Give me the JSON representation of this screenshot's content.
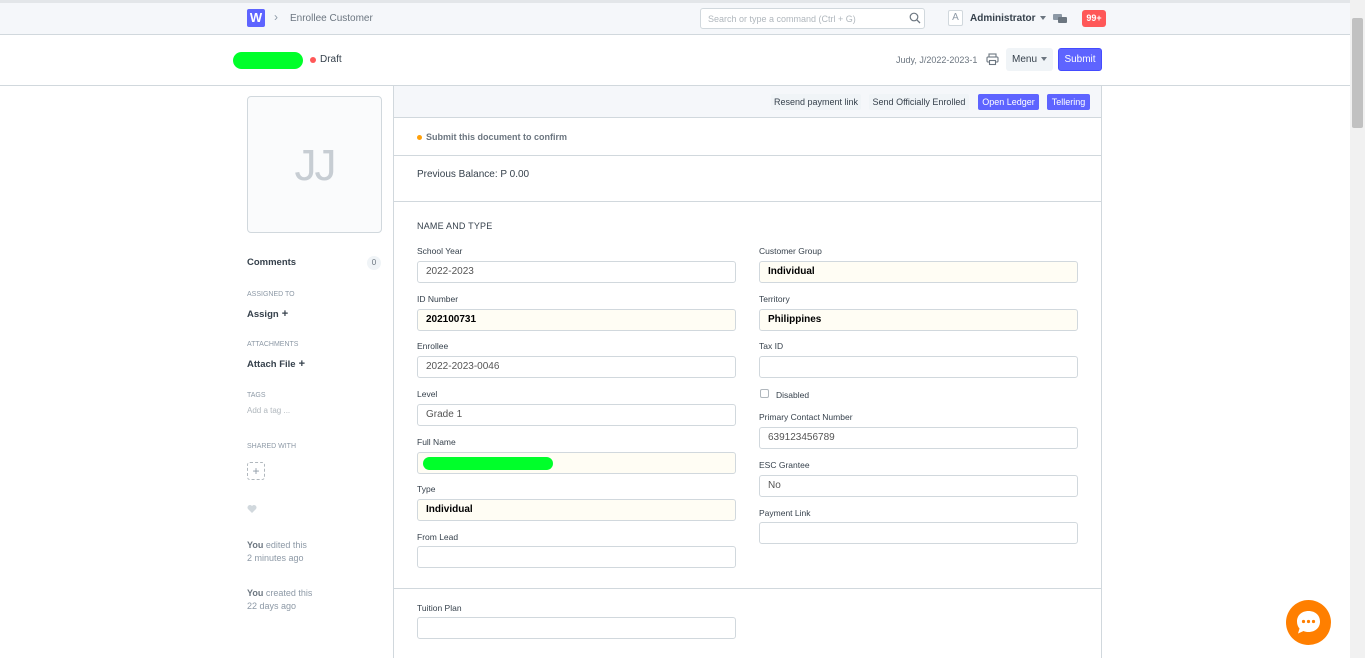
{
  "navbar": {
    "logo_letter": "W",
    "breadcrumb": "Enrollee Customer",
    "search_placeholder": "Search or type a command (Ctrl + G)",
    "user_avatar_letter": "A",
    "user_name": "Administrator",
    "notification_count": "99+"
  },
  "page_head": {
    "status": "Draft",
    "doc_id": "Judy, J/2022-2023-1",
    "menu_label": "Menu",
    "submit_label": "Submit"
  },
  "sidebar": {
    "avatar_initials": "JJ",
    "comments_label": "Comments",
    "comments_count": "0",
    "assigned_to_label": "ASSIGNED TO",
    "assign_label": "Assign",
    "attachments_label": "ATTACHMENTS",
    "attach_file_label": "Attach File",
    "tags_label": "TAGS",
    "add_tag_label": "Add a tag ...",
    "shared_with_label": "SHARED WITH",
    "timeline": [
      {
        "who": "You",
        "action": " edited this",
        "when": "2 minutes ago"
      },
      {
        "who": "You",
        "action": " created this",
        "when": "22 days ago"
      }
    ]
  },
  "toolbar": {
    "resend_payment_link": "Resend payment link",
    "send_officially_enrolled": "Send Officially Enrolled",
    "open_ledger": "Open Ledger",
    "tellering": "Tellering"
  },
  "alert": "Submit this document to confirm",
  "previous_balance": "Previous Balance: P 0.00",
  "section_title": "NAME AND TYPE",
  "fields": {
    "school_year": {
      "label": "School Year",
      "value": "2022-2023"
    },
    "id_number": {
      "label": "ID Number",
      "value": "202100731"
    },
    "enrollee": {
      "label": "Enrollee",
      "value": "2022-2023-0046"
    },
    "level": {
      "label": "Level",
      "value": "Grade 1"
    },
    "full_name": {
      "label": "Full Name",
      "value": ""
    },
    "type": {
      "label": "Type",
      "value": "Individual"
    },
    "from_lead": {
      "label": "From Lead",
      "value": ""
    },
    "customer_group": {
      "label": "Customer Group",
      "value": "Individual"
    },
    "territory": {
      "label": "Territory",
      "value": "Philippines"
    },
    "tax_id": {
      "label": "Tax ID",
      "value": ""
    },
    "disabled": {
      "label": "Disabled",
      "checked": false
    },
    "primary_contact": {
      "label": "Primary Contact Number",
      "value": "639123456789"
    },
    "esc_grantee": {
      "label": "ESC Grantee",
      "value": "No"
    },
    "payment_link": {
      "label": "Payment Link",
      "value": ""
    },
    "tuition_plan": {
      "label": "Tuition Plan",
      "value": ""
    }
  }
}
